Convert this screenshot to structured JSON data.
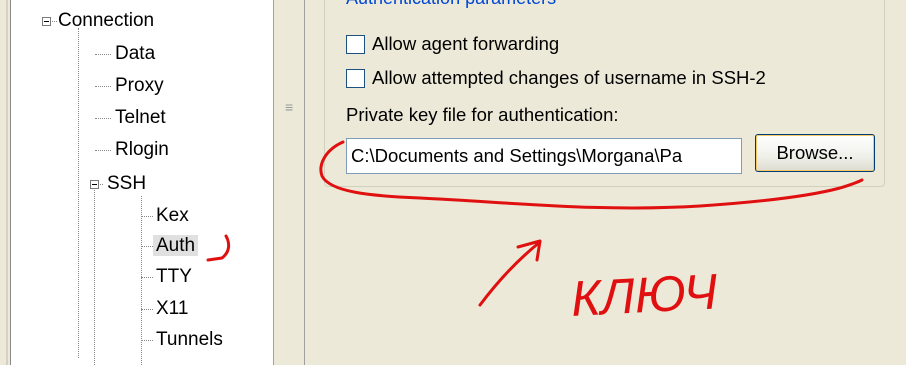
{
  "tree": {
    "items": [
      {
        "label": "Connection"
      },
      {
        "label": "Data"
      },
      {
        "label": "Proxy"
      },
      {
        "label": "Telnet"
      },
      {
        "label": "Rlogin"
      },
      {
        "label": "SSH"
      },
      {
        "label": "Kex"
      },
      {
        "label": "Auth"
      },
      {
        "label": "TTY"
      },
      {
        "label": "X11"
      },
      {
        "label": "Tunnels"
      }
    ],
    "selected": "Auth"
  },
  "auth_panel": {
    "group_title": "Authentication parameters",
    "options": [
      {
        "label": "Allow agent forwarding",
        "checked": false
      },
      {
        "label": "Allow attempted changes of username in SSH-2",
        "checked": false
      }
    ],
    "key_file_label": "Private key file for authentication:",
    "key_file_value": "C:\\Documents and Settings\\Morgana\\Pa",
    "browse_label": "Browse..."
  },
  "annotation": {
    "handwritten_text": "КЛЮЧ",
    "color": "#e01010"
  },
  "colors": {
    "panel_bg": "#ece9d8",
    "group_title": "#0046d5",
    "input_border": "#7f9db9"
  }
}
